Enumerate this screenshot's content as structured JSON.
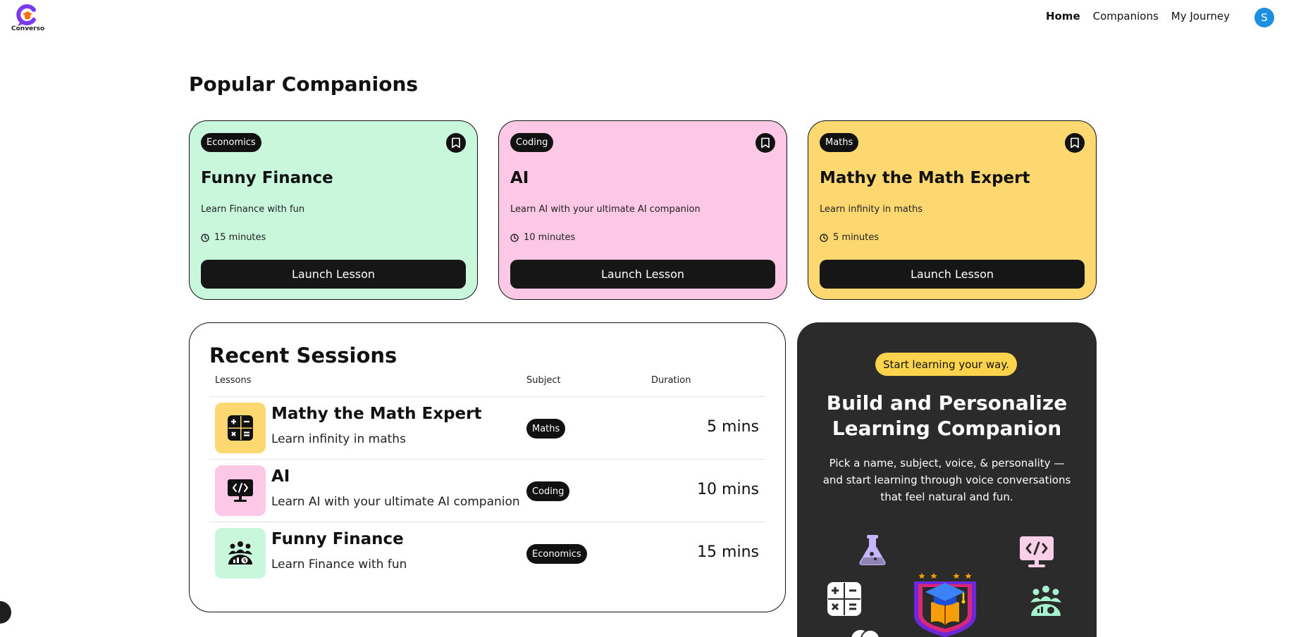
{
  "nav": {
    "logo_text": "Converso",
    "links": [
      "Home",
      "Companions",
      "My Journey"
    ],
    "avatar_letter": "S"
  },
  "popular": {
    "title": "Popular Companions",
    "cards": [
      {
        "subject": "Economics",
        "name": "Funny Finance",
        "description": "Learn Finance with fun",
        "duration": "15 minutes",
        "button": "Launch Lesson",
        "color": "#c8f7dc"
      },
      {
        "subject": "Coding",
        "name": "AI",
        "description": "Learn AI with your ultimate AI companion",
        "duration": "10 minutes",
        "button": "Launch Lesson",
        "color": "#fdc8e5"
      },
      {
        "subject": "Maths",
        "name": "Mathy the Math Expert",
        "description": "Learn infinity in maths",
        "duration": "5 minutes",
        "button": "Launch Lesson",
        "color": "#fdd770"
      }
    ]
  },
  "sessions": {
    "title": "Recent Sessions",
    "columns": [
      "Lessons",
      "Subject",
      "Duration"
    ],
    "rows": [
      {
        "name": "Mathy the Math Expert",
        "description": "Learn infinity in maths",
        "subject": "Maths",
        "duration": "5 mins",
        "icon": "calculator-icon",
        "color": "#fdd770"
      },
      {
        "name": "AI",
        "description": "Learn AI with your ultimate AI companion",
        "subject": "Coding",
        "duration": "10 mins",
        "icon": "code-monitor-icon",
        "color": "#fdc8e5"
      },
      {
        "name": "Funny Finance",
        "description": "Learn Finance with fun",
        "subject": "Economics",
        "duration": "15 mins",
        "icon": "finance-people-icon",
        "color": "#c8f7dc"
      }
    ]
  },
  "cta": {
    "pill": "Start learning your way.",
    "title": "Build and Personalize Learning Companion",
    "text": "Pick a name, subject, voice, & personality — and start learning through voice conversations that feel natural and fun."
  },
  "colors": {
    "accent_yellow": "#fcd34d",
    "cta_background": "#2b2b2b",
    "button_dark": "#161616",
    "logo_purple": "#7c3aed",
    "logo_orange": "#f97316",
    "avatar_blue": "#1d8fe0"
  }
}
